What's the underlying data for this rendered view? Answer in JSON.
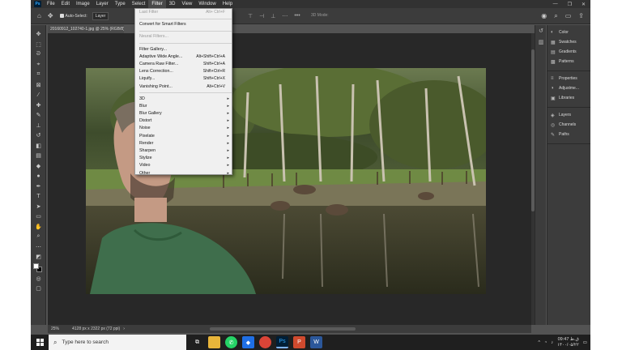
{
  "menubar": {
    "logo": "Ps",
    "items": [
      "File",
      "Edit",
      "Image",
      "Layer",
      "Type",
      "Select",
      "Filter",
      "3D",
      "View",
      "Window",
      "Help"
    ],
    "active": "Filter",
    "window_controls": [
      "—",
      "❐",
      "✕"
    ]
  },
  "options_bar": {
    "auto_select_label": "Auto-Select:",
    "auto_select_value": "Layer",
    "mode_3d_label": "3D Mode:"
  },
  "document": {
    "tab_title": "20160912_102740-1.jpg @ 25% (RGB/8)",
    "zoom": "25%",
    "status_info": "4128 px x 2322 px (72 ppi)"
  },
  "filter_menu": {
    "items": [
      {
        "label": "Last Filter",
        "shortcut": "Alt+ Ctrl+F",
        "disabled": true
      },
      {
        "sep": true
      },
      {
        "label": "Convert for Smart Filters"
      },
      {
        "sep": true
      },
      {
        "label": "Neural Filters...",
        "disabled": true
      },
      {
        "sep": true
      },
      {
        "label": "Filter Gallery..."
      },
      {
        "label": "Adaptive Wide Angle...",
        "shortcut": "Alt+Shift+Ctrl+A"
      },
      {
        "label": "Camera Raw Filter...",
        "shortcut": "Shift+Ctrl+A"
      },
      {
        "label": "Lens Correction...",
        "shortcut": "Shift+Ctrl+R"
      },
      {
        "label": "Liquify...",
        "shortcut": "Shift+Ctrl+X"
      },
      {
        "label": "Vanishing Point...",
        "shortcut": "Alt+Ctrl+V"
      },
      {
        "sep": true
      },
      {
        "label": "3D",
        "submenu": true
      },
      {
        "label": "Blur",
        "submenu": true
      },
      {
        "label": "Blur Gallery",
        "submenu": true
      },
      {
        "label": "Distort",
        "submenu": true
      },
      {
        "label": "Noise",
        "submenu": true
      },
      {
        "label": "Pixelate",
        "submenu": true
      },
      {
        "label": "Render",
        "submenu": true
      },
      {
        "label": "Sharpen",
        "submenu": true
      },
      {
        "label": "Stylize",
        "submenu": true
      },
      {
        "label": "Video",
        "submenu": true
      },
      {
        "label": "Other",
        "submenu": true
      }
    ]
  },
  "panels": {
    "groups": [
      [
        {
          "icon": "◐",
          "label": "Color"
        },
        {
          "icon": "▦",
          "label": "Swatches"
        },
        {
          "icon": "▤",
          "label": "Gradients"
        },
        {
          "icon": "▩",
          "label": "Patterns"
        }
      ],
      [
        {
          "icon": "≡",
          "label": "Properties"
        },
        {
          "icon": "◑",
          "label": "Adjustme..."
        },
        {
          "icon": "▣",
          "label": "Libraries"
        }
      ],
      [
        {
          "icon": "◈",
          "label": "Layers"
        },
        {
          "icon": "◎",
          "label": "Channels"
        },
        {
          "icon": "✎",
          "label": "Paths"
        }
      ]
    ]
  },
  "taskbar": {
    "search_placeholder": "Type here to search",
    "time": "09:47 ق.ظ",
    "date": "۱۴۰۰/۰۵/۲۲"
  },
  "colors": {
    "app_bg": "#535353",
    "panel_bg": "#3c3c3c",
    "canvas_bg": "#282828",
    "menu_bg": "#f0f0f0",
    "taskbar_bg": "#1f1f1f"
  }
}
